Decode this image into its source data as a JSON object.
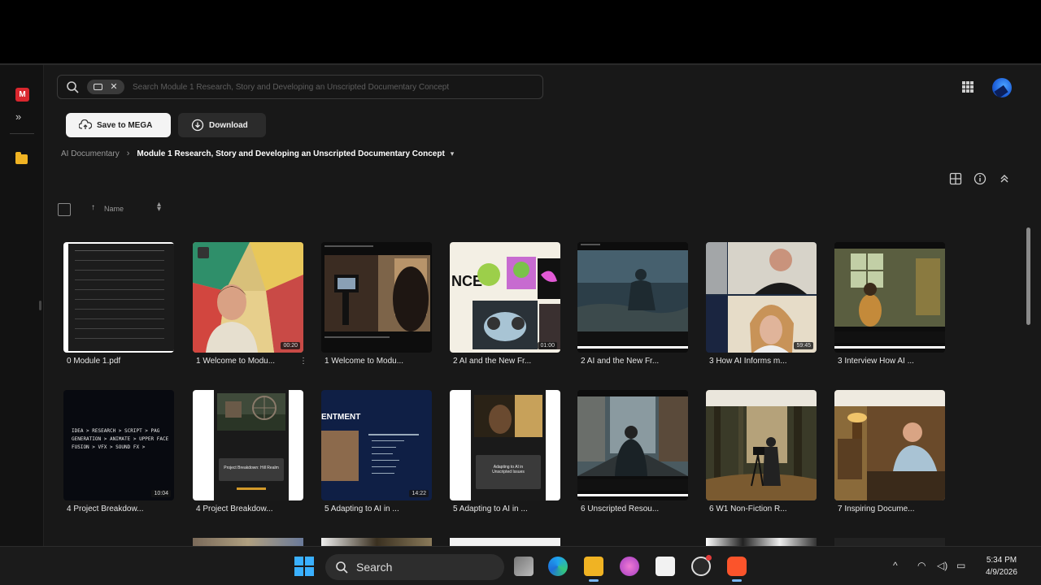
{
  "app": {
    "search_placeholder": "Search Module 1 Research, Story and Developing an Unscripted Documentary Concept",
    "buttons": {
      "save_label": "Save to MEGA",
      "download_label": "Download"
    },
    "breadcrumb": {
      "root": "AI Documentary",
      "current": "Module 1 Research, Story and Developing an Unscripted Documentary Concept"
    },
    "sort_label": "Name",
    "files": [
      {
        "label": "0 Module 1.pdf",
        "duration": "",
        "type": "pdf"
      },
      {
        "label": "1 Welcome to Modu...",
        "duration": "00:20",
        "type": "video"
      },
      {
        "label": "1 Welcome to Modu...",
        "duration": "",
        "type": "doc"
      },
      {
        "label": "2 AI and the New Fr...",
        "duration": "01:00",
        "type": "video"
      },
      {
        "label": "2 AI and the New Fr...",
        "duration": "",
        "type": "doc"
      },
      {
        "label": "3 How AI Informs m...",
        "duration": "59:45",
        "type": "video"
      },
      {
        "label": "3 Interview How AI ...",
        "duration": "",
        "type": "doc"
      },
      {
        "label": "4 Project Breakdow...",
        "duration": "10:04",
        "type": "video",
        "text": "IDEA > RESEARCH > SCRIPT > PAG GENERATION > ANIMATE > UPPER FACE FUSION > VFX > SOUND FX >"
      },
      {
        "label": "4 Project Breakdow...",
        "duration": "",
        "type": "doc",
        "caption": "Project Breakdown: Hill Realm"
      },
      {
        "label": "5 Adapting to AI in ...",
        "duration": "14:22",
        "type": "video",
        "heading": "ENTMENT"
      },
      {
        "label": "5 Adapting to AI in ...",
        "duration": "",
        "type": "doc",
        "caption": "Adapting to AI in Unscripted Issues"
      },
      {
        "label": "6 Unscripted Resou...",
        "duration": "",
        "type": "doc"
      },
      {
        "label": "6 W1 Non-Fiction R...",
        "duration": "",
        "type": "doc"
      },
      {
        "label": "7 Inspiring Docume...",
        "duration": "",
        "type": "doc"
      }
    ]
  },
  "taskbar": {
    "search_label": "Search",
    "time": "5:34 PM",
    "date": "4/9/2026"
  }
}
